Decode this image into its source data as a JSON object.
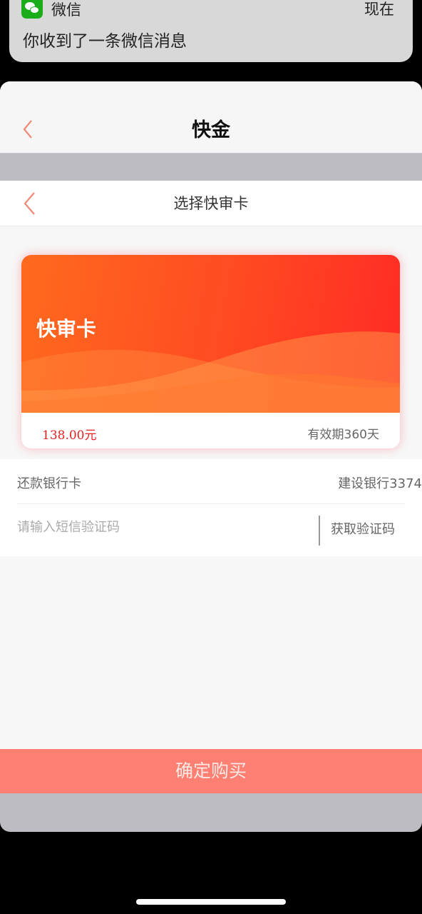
{
  "notification": {
    "app_name": "微信",
    "time": "现在",
    "message": "你收到了一条微信消息",
    "icon": "wechat-icon"
  },
  "header": {
    "title": "快金",
    "back_icon": "chevron-left-icon"
  },
  "subheader": {
    "title": "选择快审卡",
    "back_icon": "chevron-left-icon"
  },
  "card": {
    "name": "快审卡",
    "price": "138.00元",
    "validity": "有效期360天",
    "gradient_colors": [
      "#ff6a1e",
      "#ff2a24"
    ]
  },
  "form": {
    "bank_label": "还款银行卡",
    "bank_value": "建设银行3374",
    "code_placeholder": "请输入短信验证码",
    "code_value": "",
    "get_code_label": "获取验证码"
  },
  "confirm_button": {
    "label": "确定购买",
    "color": "#fd8073"
  }
}
